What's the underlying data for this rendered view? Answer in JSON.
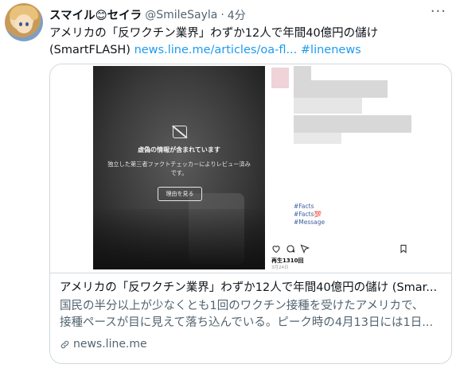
{
  "tweet": {
    "display_name": "スマイル😊セイラ",
    "handle": "@SmileSayla",
    "separator": "·",
    "time": "4分",
    "more_icon": "more-horizontal-icon",
    "text_line1": "アメリカの「反ワクチン業界」わずか12人で年間40億円の儲け",
    "text_source": "(SmartFLASH) ",
    "text_url": "news.line.me/articles/oa-fl...",
    "text_hashtag": "#linenews"
  },
  "card": {
    "video_overlay": {
      "title": "虚偽の情報が含まれています",
      "body": "独立した第三者ファクトチェッカーによりレビュー済みです。",
      "button": "理由を見る"
    },
    "post": {
      "hashtag1": "#Facts",
      "hashtag2": "#Facts💯",
      "hashtag3": "#Message",
      "likes": "再生1310回",
      "date": "3月24日"
    },
    "title": "アメリカの「反ワクチン業界」わずか12人で年間40億円の儲け (Smar...",
    "desc_line1": "国民の半分以上が少なくとも1回のワクチン接種を受けたアメリカで、",
    "desc_line2": "接種ペースが目に見えて落ち込んでいる。ピーク時の4月13日には1日...",
    "domain": "news.line.me"
  },
  "colors": {
    "link": "#1d9bf0",
    "text": "#0f1419",
    "secondary": "#536471",
    "border": "#cfd9de"
  }
}
